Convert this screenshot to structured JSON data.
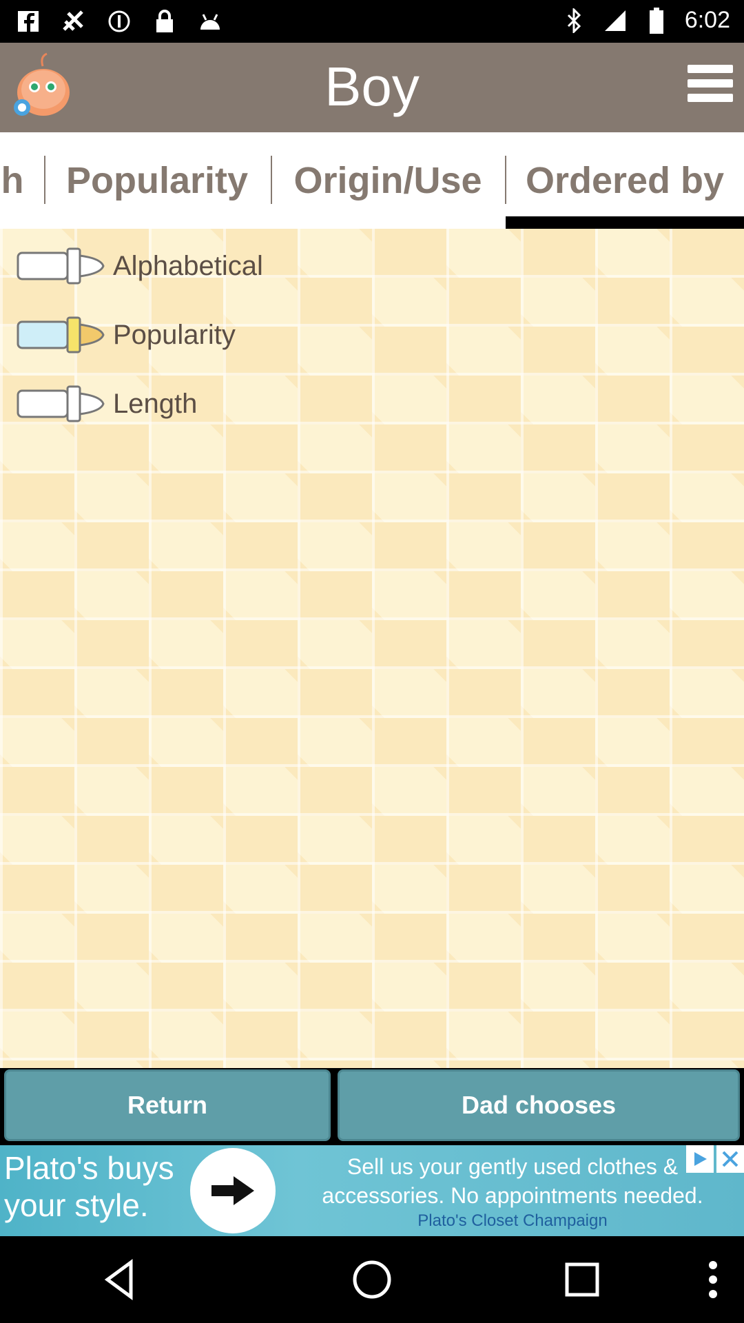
{
  "status_bar": {
    "time": "6:02",
    "left_icons": [
      "facebook-icon",
      "airplane-wifi-icon",
      "info-icon",
      "lock-icon",
      "android-icon"
    ],
    "right_icons": [
      "bluetooth-icon",
      "signal-icon",
      "battery-icon"
    ]
  },
  "app_bar": {
    "title": "Boy",
    "logo_icon": "baby-face-icon",
    "menu_icon": "hamburger-menu-icon"
  },
  "tabs": [
    {
      "label": "h",
      "selected": false
    },
    {
      "label": "Popularity",
      "selected": false
    },
    {
      "label": "Origin/Use",
      "selected": false
    },
    {
      "label": "Ordered by",
      "selected": true
    }
  ],
  "options": [
    {
      "label": "Alphabetical",
      "selected": false
    },
    {
      "label": "Popularity",
      "selected": true
    },
    {
      "label": "Length",
      "selected": false
    }
  ],
  "buttons": {
    "return": "Return",
    "dad_chooses": "Dad chooses"
  },
  "ad": {
    "left_line1": "Plato's buys",
    "left_line2": "your style.",
    "text_line1": "Sell us your gently used clothes &",
    "text_line2": "accessories. No appointments needed.",
    "sub": "Plato's Closet Champaign"
  },
  "nav": [
    "back-icon",
    "home-icon",
    "recents-icon",
    "more-icon"
  ],
  "colors": {
    "app_bar": "#857970",
    "tab_text": "#857970",
    "button": "#5f9ea8",
    "content_bg": "#fdf3d3",
    "ad_bg": "#4fb3c8"
  }
}
